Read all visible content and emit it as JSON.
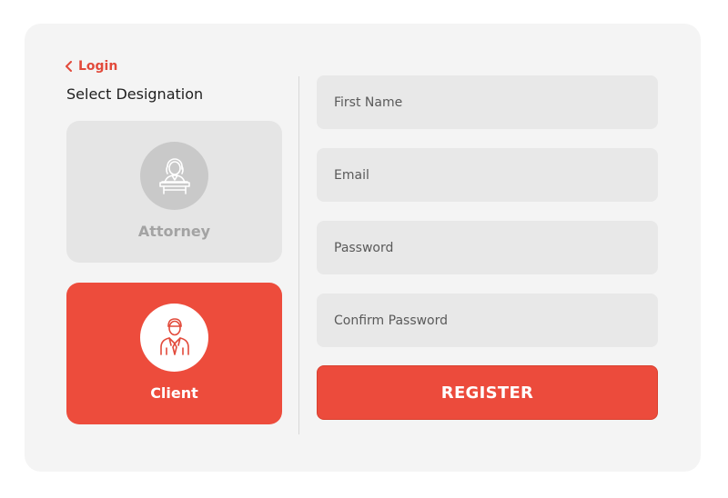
{
  "back_link": {
    "label": "Login",
    "icon": "chevron-left-icon"
  },
  "designation": {
    "title": "Select Designation",
    "options": [
      {
        "label": "Attorney",
        "icon": "attorney-at-podium-icon",
        "selected": false
      },
      {
        "label": "Client",
        "icon": "client-person-icon",
        "selected": true
      }
    ]
  },
  "form": {
    "first_name": {
      "placeholder": "First Name",
      "value": ""
    },
    "email": {
      "placeholder": "Email",
      "value": ""
    },
    "password": {
      "placeholder": "Password",
      "value": ""
    },
    "confirm_password": {
      "placeholder": "Confirm Password",
      "value": ""
    },
    "submit_label": "REGISTER"
  },
  "colors": {
    "accent": "#ec4b3c",
    "card_background": "#f4f4f4",
    "field_background": "#e8e8e8",
    "unselected_role": "#e5e5e5"
  }
}
